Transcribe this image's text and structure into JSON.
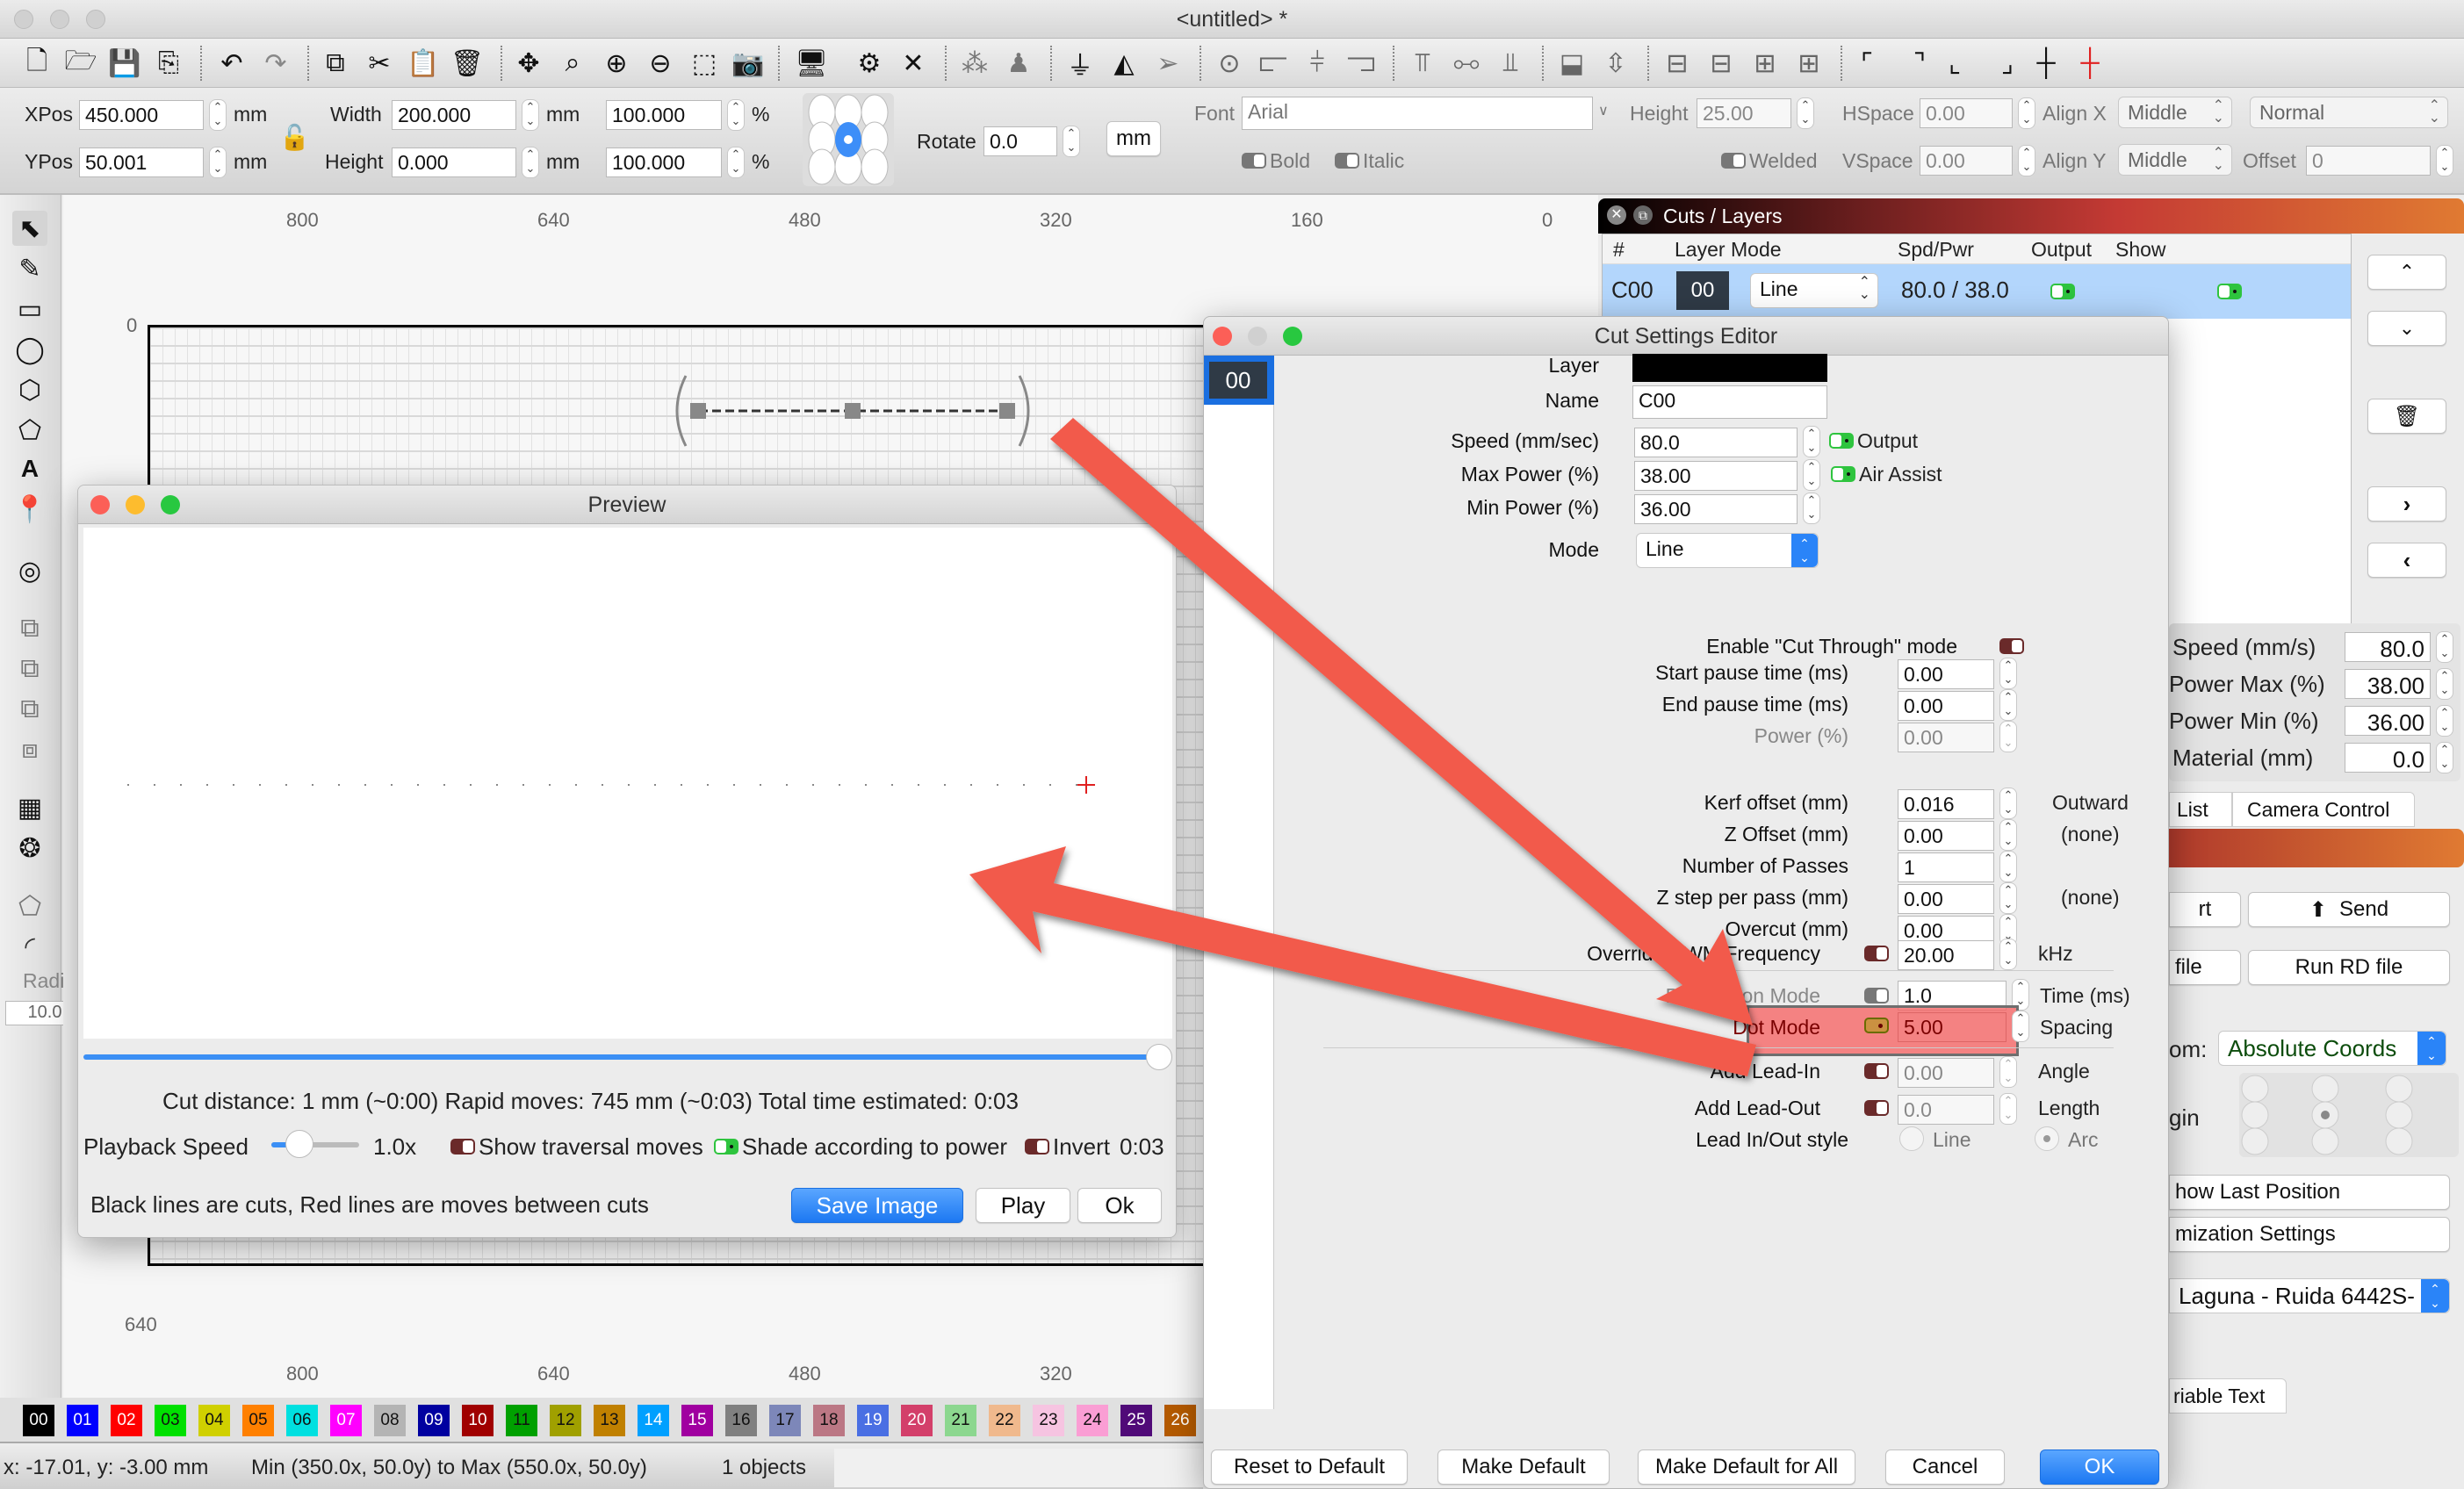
{
  "window": {
    "title": "<untitled> *"
  },
  "toolbar": {
    "icons": [
      "new-file-icon",
      "open-folder-icon",
      "save-icon",
      "import-icon",
      "undo-icon",
      "redo-icon",
      "copy-icon",
      "cut-icon",
      "paste-icon",
      "delete-icon",
      "move-icon",
      "zoom-page-icon",
      "zoom-in-icon",
      "zoom-out-icon",
      "frame-icon",
      "camera-icon",
      "monitor-icon",
      "settings-gear-icon",
      "tools-icon",
      "group-icon",
      "user-icon",
      "flip-vertical-icon",
      "mirror-icon",
      "send-icon",
      "target-icon",
      "align-left-icon",
      "align-center-icon",
      "align-right-icon",
      "align-top-icon",
      "align-middle-icon",
      "align-bottom-icon",
      "dist-h-icon",
      "dist-v-icon",
      "spacing-1-icon",
      "spacing-2-icon",
      "spacing-3-icon",
      "spacing-4-icon",
      "corner-tl-icon",
      "corner-tr-icon",
      "corner-bl-icon",
      "corner-br-icon",
      "crosshair-icon",
      "laser-crosshair-icon"
    ]
  },
  "props": {
    "xpos_label": "XPos",
    "xpos": "450.000",
    "ypos_label": "YPos",
    "ypos": "50.001",
    "unit_mm": "mm",
    "width_label": "Width",
    "width": "200.000",
    "height_label": "Height",
    "height": "0.000",
    "scale_w": "100.000",
    "scale_h": "100.000",
    "pct": "%",
    "rotate_label": "Rotate",
    "rotate": "0.0",
    "unit_button": "mm",
    "font_label": "Font",
    "font": "Arial",
    "text_height_label": "Height",
    "text_height": "25.00",
    "hspace_label": "HSpace",
    "hspace": "0.00",
    "vspace_label": "VSpace",
    "vspace": "0.00",
    "alignx_label": "Align X",
    "alignx": "Middle",
    "aligny_label": "Align Y",
    "aligny": "Middle",
    "style": "Normal",
    "offset_label": "Offset",
    "offset": "0",
    "bold_label": "Bold",
    "italic_label": "Italic",
    "welded_label": "Welded"
  },
  "tools": {
    "items": [
      "select-arrow-icon",
      "pencil-icon",
      "rectangle-icon",
      "ellipse-icon",
      "polygon-icon",
      "shape-icon",
      "text-icon",
      "position-pin-icon",
      "offset-icon",
      "boolean-union-icon",
      "boolean-subtract-icon",
      "boolean-intersect-icon",
      "boolean-weld-icon",
      "grid-array-icon",
      "circular-array-icon",
      "node-edit-icon",
      "corner-radius-icon"
    ],
    "radius_label": "Radius",
    "radius": "10.0"
  },
  "canvas": {
    "ruler_top": [
      "800",
      "640",
      "480",
      "320",
      "160",
      "0"
    ],
    "ruler_bottom": [
      "800",
      "640",
      "480",
      "320"
    ],
    "ruler_left_top": "0",
    "ruler_left_bottom": "640"
  },
  "palette": [
    {
      "label": "00",
      "color": "#000000",
      "text": "#ffffff"
    },
    {
      "label": "01",
      "color": "#0000ff",
      "text": "#ffffff"
    },
    {
      "label": "02",
      "color": "#ff0000",
      "text": "#ffffff"
    },
    {
      "label": "03",
      "color": "#00e000",
      "text": "#111111"
    },
    {
      "label": "04",
      "color": "#d0d000",
      "text": "#111111"
    },
    {
      "label": "05",
      "color": "#ff8000",
      "text": "#111111"
    },
    {
      "label": "06",
      "color": "#00e0e0",
      "text": "#111111"
    },
    {
      "label": "07",
      "color": "#ff00ff",
      "text": "#ffffff"
    },
    {
      "label": "08",
      "color": "#b4b4b4",
      "text": "#111111"
    },
    {
      "label": "09",
      "color": "#0000a0",
      "text": "#ffffff"
    },
    {
      "label": "10",
      "color": "#a00000",
      "text": "#ffffff"
    },
    {
      "label": "11",
      "color": "#00a000",
      "text": "#111111"
    },
    {
      "label": "12",
      "color": "#a0a000",
      "text": "#111111"
    },
    {
      "label": "13",
      "color": "#c08000",
      "text": "#111111"
    },
    {
      "label": "14",
      "color": "#00a0ff",
      "text": "#ffffff"
    },
    {
      "label": "15",
      "color": "#a000a0",
      "text": "#ffffff"
    },
    {
      "label": "16",
      "color": "#808080",
      "text": "#111111"
    },
    {
      "label": "17",
      "color": "#7d87b9",
      "text": "#111111"
    },
    {
      "label": "18",
      "color": "#bb7784",
      "text": "#111111"
    },
    {
      "label": "19",
      "color": "#4a6fe3",
      "text": "#ffffff"
    },
    {
      "label": "20",
      "color": "#d33f6a",
      "text": "#ffffff"
    },
    {
      "label": "21",
      "color": "#8cd78f",
      "text": "#111111"
    },
    {
      "label": "22",
      "color": "#f0b98d",
      "text": "#111111"
    },
    {
      "label": "23",
      "color": "#f6c4e1",
      "text": "#111111"
    },
    {
      "label": "24",
      "color": "#fa9ed4",
      "text": "#111111"
    },
    {
      "label": "25",
      "color": "#500a78",
      "text": "#ffffff"
    },
    {
      "label": "26",
      "color": "#b45a00",
      "text": "#ffffff"
    }
  ],
  "status": {
    "coords": "x: -17.01, y: -3.00 mm",
    "bounds": "Min (350.0x, 50.0y) to Max (550.0x, 50.0y)",
    "objects": "1 objects"
  },
  "preview": {
    "title": "Preview",
    "stats": "Cut distance: 1 mm (~0:00)   Rapid moves: 745 mm (~0:03)   Total time estimated: 0:03",
    "playback_label": "Playback Speed",
    "playback_value": "1.0x",
    "playback_fraction": 0.25,
    "progress_fraction": 1.0,
    "show_traversal": "Show traversal moves",
    "shade_power": "Shade according to power",
    "invert": "Invert",
    "time": "0:03",
    "legend": "Black lines are cuts, Red lines are moves between cuts",
    "save_image": "Save Image",
    "play": "Play",
    "ok": "Ok"
  },
  "cuts_panel": {
    "title": "Cuts / Layers",
    "columns": [
      "#",
      "Layer",
      "Mode",
      "Spd/Pwr",
      "Output",
      "Show"
    ],
    "rows": [
      {
        "num": "C00",
        "layer": "00",
        "mode": "Line",
        "spdpwr": "80.0 / 38.0",
        "output": true,
        "show": true
      }
    ],
    "speed_label": "Speed (mm/s)",
    "speed": "80.0",
    "pmax_label": "Power Max (%)",
    "pmax": "38.00",
    "pmin_label": "Power Min (%)",
    "pmin": "36.00",
    "material_label": "Material (mm)",
    "material": "0.0",
    "tab_list": "List",
    "tab_camera": "Camera Control",
    "btn_start": "rt",
    "btn_send": "Send",
    "btn_save_rd": "file",
    "btn_run_rd": "Run RD file",
    "from_label": "om:",
    "from_value": "Absolute Coords",
    "origin_label": "gin",
    "show_last": "how Last Position",
    "optim": "mization Settings",
    "device": "Laguna - Ruida 6442S-",
    "variable_text": "riable Text"
  },
  "cut_settings": {
    "title": "Cut Settings Editor",
    "layer_list": [
      "00"
    ],
    "layer_label": "Layer",
    "layer_color": "#000000",
    "name_label": "Name",
    "name": "C00",
    "speed_label": "Speed (mm/sec)",
    "speed": "80.0",
    "output_label": "Output",
    "maxp_label": "Max Power (%)",
    "maxp": "38.00",
    "air_label": "Air Assist",
    "minp_label": "Min Power (%)",
    "minp": "36.00",
    "mode_label": "Mode",
    "mode": "Line",
    "cut_through_label": "Enable \"Cut Through\" mode",
    "start_pause_label": "Start pause time (ms)",
    "start_pause": "0.00",
    "end_pause_label": "End pause time (ms)",
    "end_pause": "0.00",
    "power_label": "Power (%)",
    "power": "0.00",
    "kerf_label": "Kerf offset (mm)",
    "kerf": "0.016",
    "kerf_dir": "Outward",
    "zoffset_label": "Z Offset (mm)",
    "zoffset": "0.00",
    "zoffset_note": "(none)",
    "passes_label": "Number of Passes",
    "passes": "1",
    "zstep_label": "Z step per pass (mm)",
    "zstep": "0.00",
    "zstep_note": "(none)",
    "overcut_label": "Overcut (mm)",
    "overcut": "0.00",
    "pwm_label": "Override PWM Frequency",
    "pwm": "20.00",
    "pwm_unit": "kHz",
    "perf_label": "Perforation Mode",
    "perf": "1.0",
    "perf_unit": "Time (ms)",
    "dot_label": "Dot Mode",
    "dot": "5.00",
    "dot_unit": "Spacing",
    "leadin_label": "Add Lead-In",
    "leadin": "0.00",
    "leadin_unit": "Angle",
    "leadout_label": "Add Lead-Out",
    "leadout": "0.0",
    "leadout_unit": "Length",
    "leadstyle_label": "Lead In/Out style",
    "style_line": "Line",
    "style_arc": "Arc",
    "reset": "Reset to Default",
    "make_default": "Make Default",
    "make_default_all": "Make Default for All",
    "cancel": "Cancel",
    "ok": "OK"
  },
  "annotation": {
    "arrow_color": "#f25a4c"
  }
}
